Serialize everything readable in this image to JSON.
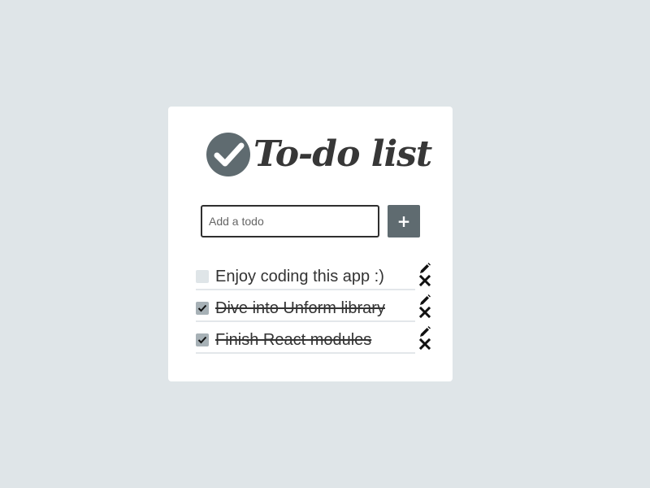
{
  "app": {
    "title": "To-do list"
  },
  "add_form": {
    "placeholder": "Add a todo",
    "value": "",
    "button_label": "+"
  },
  "todos": [
    {
      "text": "Enjoy coding this app :)",
      "completed": false
    },
    {
      "text": "Dive into Unform library",
      "completed": true
    },
    {
      "text": "Finish React modules",
      "completed": true
    }
  ],
  "icons": {
    "logo": "check-circle-icon",
    "edit": "pencil-icon",
    "delete": "x-icon",
    "checked": "checkmark-icon"
  },
  "colors": {
    "background": "#dfe5e8",
    "card": "#ffffff",
    "accent": "#5f6b70",
    "text": "#333333",
    "checkbox_unchecked": "#dfe5e8",
    "checkbox_checked": "#a7b1b6"
  }
}
